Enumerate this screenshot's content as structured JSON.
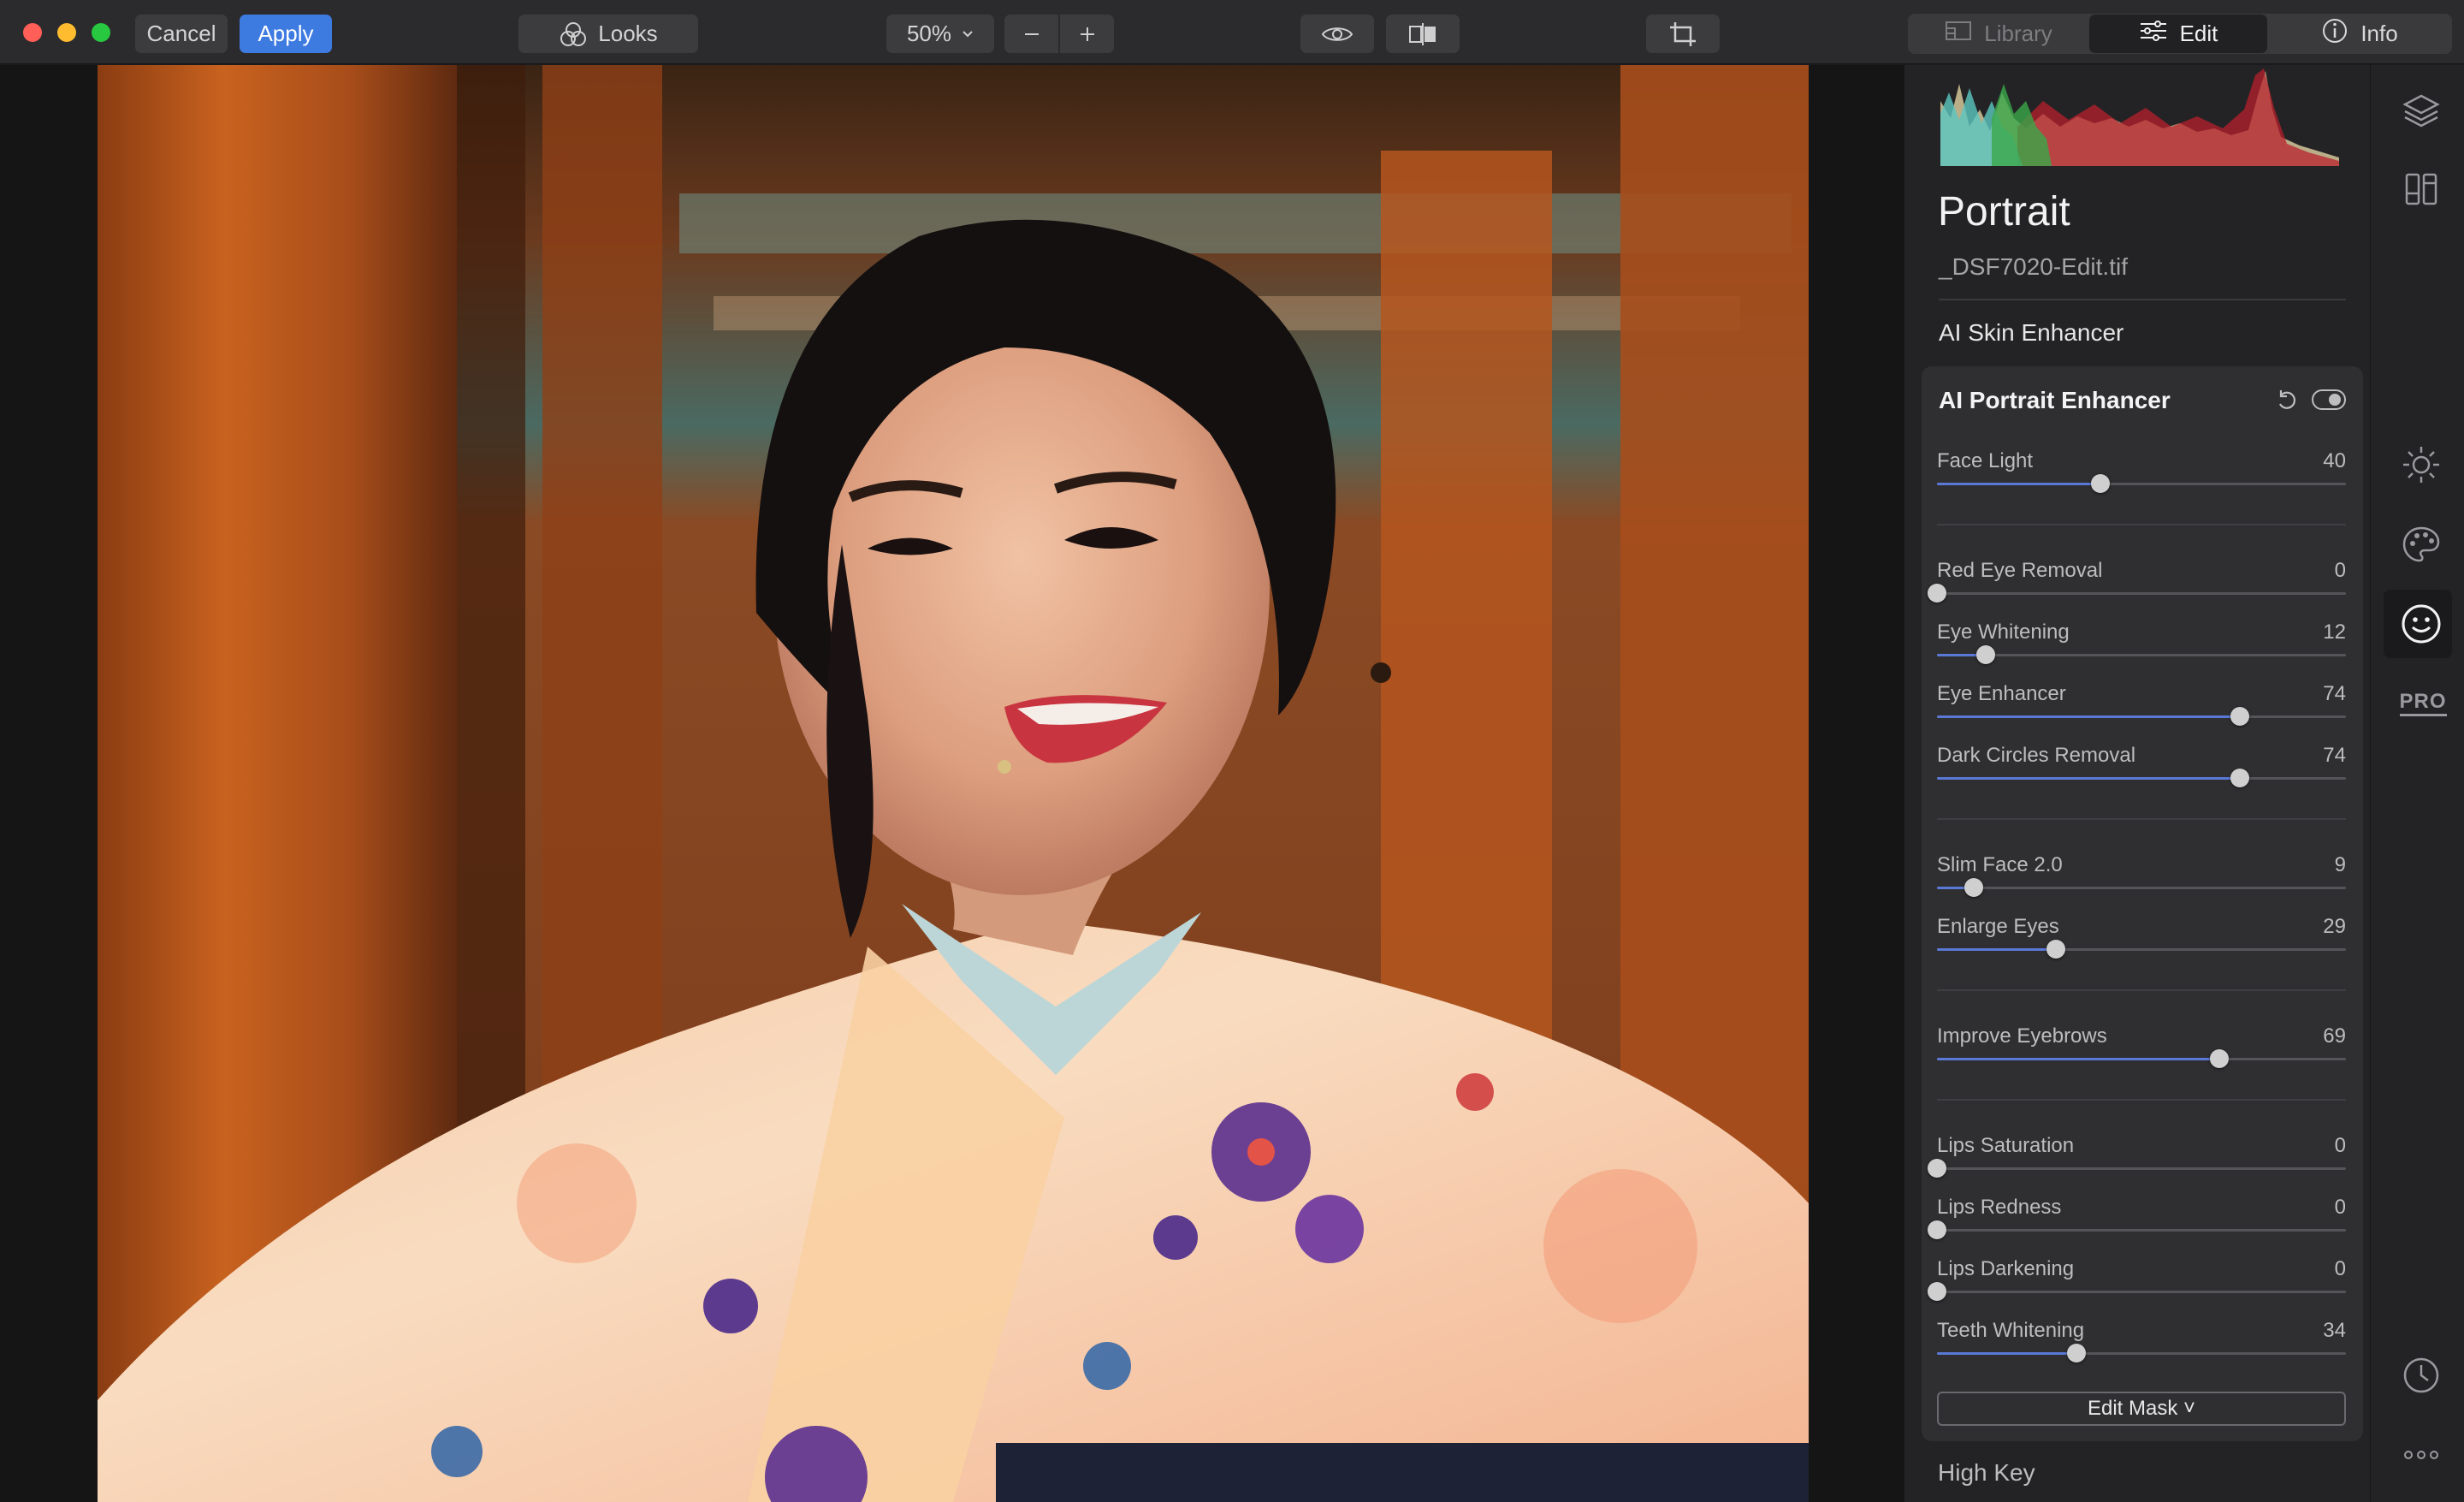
{
  "toolbar": {
    "cancel": "Cancel",
    "apply": "Apply",
    "looks": "Looks",
    "zoom": "50%",
    "library": "Library",
    "edit": "Edit",
    "info": "Info"
  },
  "panel": {
    "title": "Portrait",
    "filename": "_DSF7020-Edit.tif",
    "section_skin": "AI Skin Enhancer",
    "section_portrait": "AI Portrait Enhancer",
    "sliders": [
      {
        "label": "Face Light",
        "value": "40",
        "pct": 40
      },
      {
        "label": "Red Eye Removal",
        "value": "0",
        "pct": 0
      },
      {
        "label": "Eye Whitening",
        "value": "12",
        "pct": 12
      },
      {
        "label": "Eye Enhancer",
        "value": "74",
        "pct": 74
      },
      {
        "label": "Dark Circles Removal",
        "value": "74",
        "pct": 74
      },
      {
        "label": "Slim Face 2.0",
        "value": "9",
        "pct": 9
      },
      {
        "label": "Enlarge Eyes",
        "value": "29",
        "pct": 29
      },
      {
        "label": "Improve Eyebrows",
        "value": "69",
        "pct": 69
      },
      {
        "label": "Lips Saturation",
        "value": "0",
        "pct": 0
      },
      {
        "label": "Lips Redness",
        "value": "0",
        "pct": 0
      },
      {
        "label": "Lips Darkening",
        "value": "0",
        "pct": 0
      },
      {
        "label": "Teeth Whitening",
        "value": "34",
        "pct": 34
      }
    ],
    "edit_mask": "Edit Mask ˅",
    "next_section": "High Key"
  },
  "rail": {
    "pro_label": "PRO"
  },
  "colors": {
    "accent": "#3d7be0",
    "slider_fill": "#5a79d6"
  },
  "icons": [
    "looks-icon",
    "eye-icon",
    "compare-icon",
    "crop-icon",
    "library-icon",
    "sliders-icon",
    "info-icon",
    "layers-icon",
    "panels-icon",
    "sun-icon",
    "palette-icon",
    "face-icon",
    "history-icon",
    "more-icon",
    "undo-icon",
    "toggle-icon"
  ]
}
